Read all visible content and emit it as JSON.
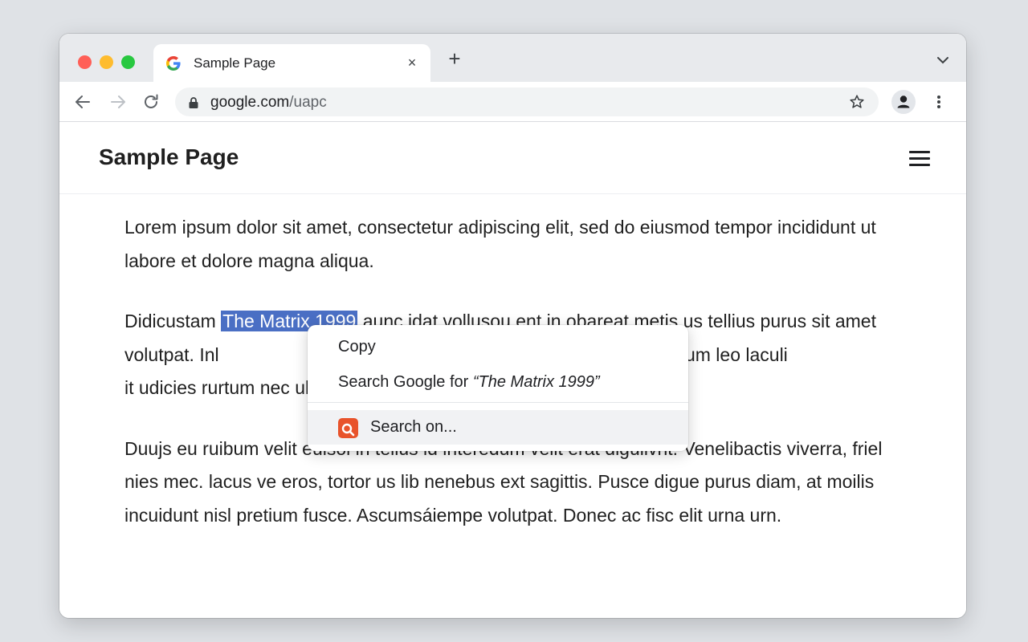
{
  "browser": {
    "tab_title": "Sample Page",
    "tab_close_glyph": "×",
    "new_tab_glyph": "+",
    "url_host": "google.com",
    "url_path": "/uapc"
  },
  "page": {
    "site_title": "Sample Page",
    "paragraph1": "Lorem ipsum dolor sit amet, consectetur adipiscing elit, sed do eiusmod tempor incididunt ut labore et dolore magna aliqua.",
    "paragraph2_before": "Didicustam ",
    "paragraph2_selected": "The Matrix 1999",
    "paragraph2_after": " aunc idat vollusou ent in obareat metis us tellius purus sit amet volutpat. Inl                                              eus finacus varrona. Veiticulum leo laculi                                               it udicies rurtum nec ulcentpr set, gr",
    "paragraph3": "Duujs eu ruibum velit euisoi in tellus id interedum velit erat diguilvnt. Venelibactis viverra, friel nies mec. lacus ve eros, tortor us lib nenebus ext sagittis. Pusce digue purus diam, at moilis incuidunt nisl pretium fusce. Ascumsáiempe volutpat. Donec ac fisc elit urna urn."
  },
  "context_menu": {
    "copy": "Copy",
    "search_google_prefix": "Search Google for ",
    "search_google_query": "“The Matrix 1999”",
    "search_on": "Search on..."
  },
  "colors": {
    "selection": "#4a6fc4",
    "search_on_icon": "#e8532b"
  }
}
